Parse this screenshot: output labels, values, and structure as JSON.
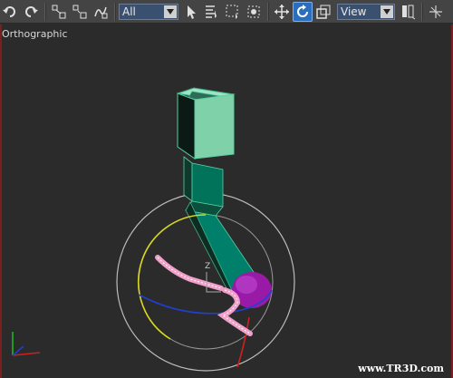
{
  "toolbar": {
    "selection_filter": "All",
    "reference_coord": "View"
  },
  "viewport": {
    "label": "Orthographic"
  },
  "gizmo": {
    "axis_label": "Z"
  },
  "watermark": "www.TR3D.com",
  "colors": {
    "toolbar_bg": "#444444",
    "viewport_bg": "#2b2b2b",
    "active_border": "#7a1e1e",
    "cube_fill": "#7fd1a9",
    "spline_pink": "#f0a0c8",
    "sphere_purple": "#9a1aa8"
  },
  "icons": [
    "undo-icon",
    "redo-icon",
    "select-and-link-icon",
    "unlink-icon",
    "bind-space-warp-icon",
    "select-object-icon",
    "select-by-name-icon",
    "rect-selection-icon",
    "window-crossing-icon",
    "select-move-icon",
    "select-rotate-icon",
    "select-scale-icon",
    "pivot-center-icon",
    "snap-icon"
  ]
}
